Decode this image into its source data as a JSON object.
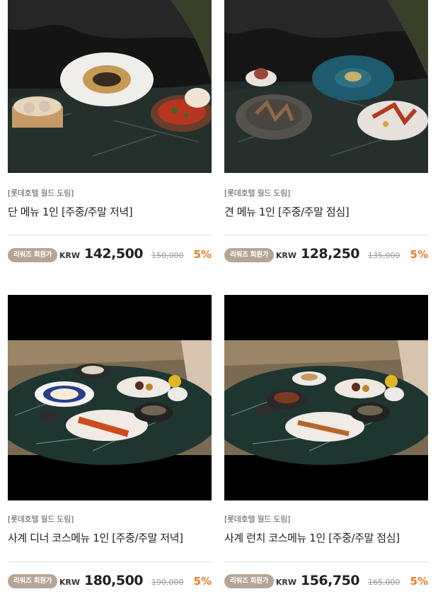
{
  "products": [
    {
      "brand": "[롯데호텔 월드 도림]",
      "title": "단 메뉴 1인 [주중/주말 저녁]",
      "badge": "리워즈 회원가",
      "currency": "KRW",
      "price": "142,500",
      "original_price": "150,000",
      "discount": "5%",
      "image_icon": "dim-sum-dish-photo"
    },
    {
      "brand": "[롯데호텔 월드 도림]",
      "title": "견 메뉴 1인 [주중/주말 점심]",
      "badge": "리워즈 회원가",
      "currency": "KRW",
      "price": "128,250",
      "original_price": "135,000",
      "discount": "5%",
      "image_icon": "plated-course-photo"
    },
    {
      "brand": "[롯데호텔 월드 도림]",
      "title": "사계 디너 코스메뉴 1인 [주중/주말 저녁]",
      "badge": "리워즈 회원가",
      "currency": "KRW",
      "price": "180,500",
      "original_price": "190,000",
      "discount": "5%",
      "image_icon": "dinner-course-table-photo"
    },
    {
      "brand": "[롯데호텔 월드 도림]",
      "title": "사계 런치 코스메뉴 1인 [주중/주말 점심]",
      "badge": "리워즈 회원가",
      "currency": "KRW",
      "price": "156,750",
      "original_price": "165,000",
      "discount": "5%",
      "image_icon": "lunch-course-table-photo"
    }
  ],
  "colors": {
    "badge_bg": "#b5a595",
    "discount": "#f07a25",
    "price": "#222222",
    "strike": "#999999"
  }
}
